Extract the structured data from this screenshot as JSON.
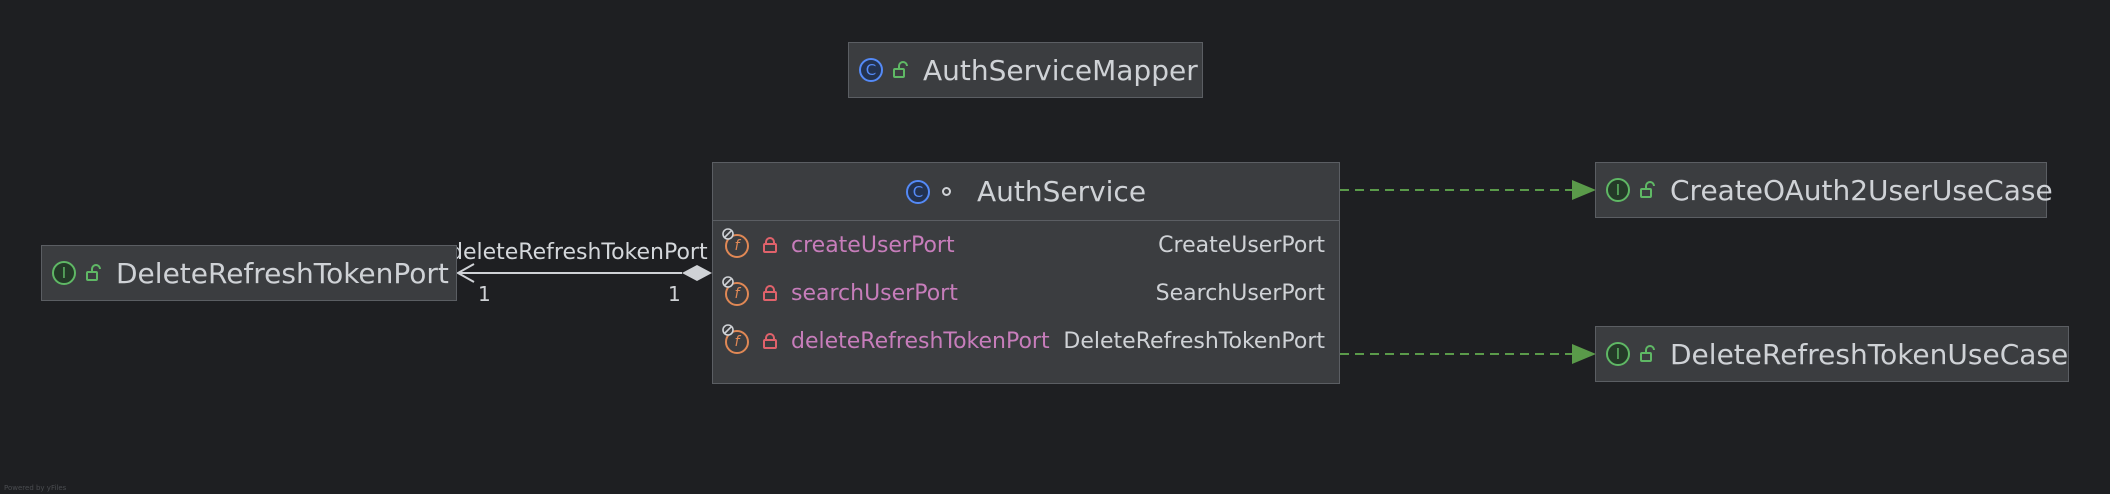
{
  "diagram": {
    "nodes": {
      "auth_service_mapper": {
        "kind": "class",
        "kind_glyph": "C",
        "title": "AuthServiceMapper",
        "visibility_icon": "unlock-icon"
      },
      "auth_service": {
        "kind": "class",
        "kind_glyph": "C",
        "title": "AuthService",
        "visibility_icon": "package-private-dot-icon",
        "fields": [
          {
            "name": "createUserPort",
            "type": "CreateUserPort",
            "icon": "final-field-icon",
            "access_icon": "lock-icon"
          },
          {
            "name": "searchUserPort",
            "type": "SearchUserPort",
            "icon": "final-field-icon",
            "access_icon": "lock-icon"
          },
          {
            "name": "deleteRefreshTokenPort",
            "type": "DeleteRefreshTokenPort",
            "icon": "final-field-icon",
            "access_icon": "lock-icon"
          }
        ]
      },
      "delete_refresh_token_port": {
        "kind": "interface",
        "kind_glyph": "I",
        "title": "DeleteRefreshTokenPort",
        "visibility_icon": "unlock-icon"
      },
      "create_oauth2_user_use_case": {
        "kind": "interface",
        "kind_glyph": "I",
        "title": "CreateOAuth2UserUseCase",
        "visibility_icon": "unlock-icon"
      },
      "delete_refresh_token_use_case": {
        "kind": "interface",
        "kind_glyph": "I",
        "title": "DeleteRefreshTokenUseCase",
        "visibility_icon": "unlock-icon"
      }
    },
    "edges": {
      "composition": {
        "from": "AuthService",
        "to": "DeleteRefreshTokenPort",
        "label": "deleteRefreshTokenPort",
        "source_multiplicity": "1",
        "target_multiplicity": "1"
      },
      "realization_create": {
        "from": "AuthService",
        "to": "CreateOAuth2UserUseCase",
        "style": "dashed"
      },
      "realization_delete": {
        "from": "AuthService",
        "to": "DeleteRefreshTokenUseCase",
        "style": "dashed"
      }
    },
    "colors": {
      "background": "#1e1f22",
      "node_fill": "#3b3d40",
      "node_border": "#5b5e63",
      "class_icon": "#548af7",
      "interface_icon": "#5fb865",
      "field_icon": "#e08855",
      "field_name": "#c77dbb",
      "lock": "#e0626b",
      "realization_edge": "#5a9a4a",
      "composition_edge": "#cfd2d6"
    }
  },
  "watermark": "Powered by yFiles"
}
